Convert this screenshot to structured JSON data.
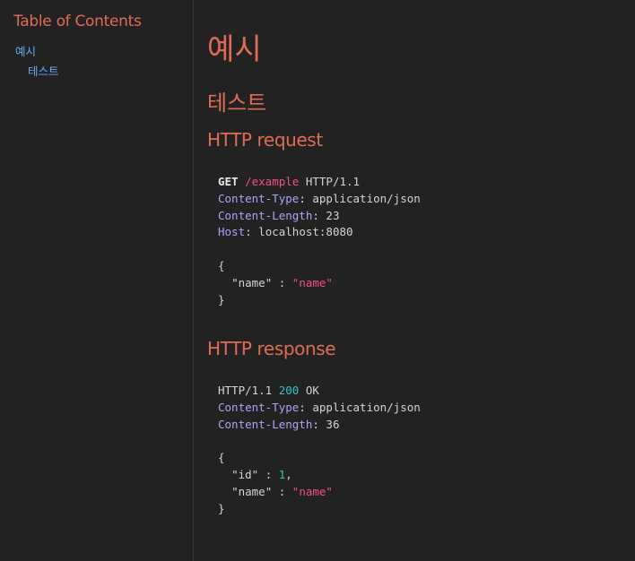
{
  "sidebar": {
    "title": "Table of Contents",
    "items": [
      {
        "label": "예시",
        "level": 1
      },
      {
        "label": "테스트",
        "level": 2
      }
    ]
  },
  "main": {
    "heading1": "예시",
    "heading2": "테스트",
    "request": {
      "heading": "HTTP request",
      "method": "GET",
      "path": "/example",
      "version": "HTTP/1.1",
      "headers": [
        {
          "name": "Content-Type",
          "value": "application/json"
        },
        {
          "name": "Content-Length",
          "value": "23"
        },
        {
          "name": "Host",
          "value": "localhost:8080"
        }
      ],
      "body": {
        "open": "{",
        "key": "\"name\"",
        "sep": " : ",
        "value": "\"name\"",
        "close": "}"
      }
    },
    "response": {
      "heading": "HTTP response",
      "version": "HTTP/1.1",
      "status_code": "200",
      "status_text": "OK",
      "headers": [
        {
          "name": "Content-Type",
          "value": "application/json"
        },
        {
          "name": "Content-Length",
          "value": "36"
        }
      ],
      "body": {
        "open": "{",
        "id_key": "\"id\"",
        "id_value": "1",
        "name_key": "\"name\"",
        "name_value": "\"name\"",
        "close": "}"
      }
    }
  },
  "colors": {
    "background": "#222222",
    "heading": "#e06c55",
    "link": "#6aaaf0",
    "header_name": "#a9a6f5",
    "string": "#f0508a",
    "number": "#35c4c0"
  }
}
